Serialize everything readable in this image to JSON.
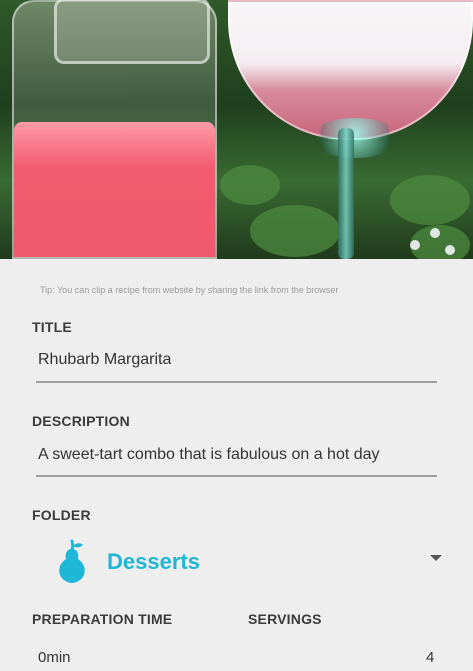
{
  "header_photo": {
    "description": ""
  },
  "form": {
    "tip": "Tip: You can clip a recipe from website by sharing the link from the browser",
    "title_label": "TITLE",
    "title_value": "Rhubarb Margarita",
    "description_label": "DESCRIPTION",
    "description_value": "A sweet-tart combo that is fabulous on a hot day",
    "folder_label": "FOLDER",
    "folder_value": "Desserts",
    "folder_icon": "pear-icon",
    "prep_label": "PREPARATION TIME",
    "prep_value": "0min",
    "servings_label": "SERVINGS",
    "servings_value": "4"
  },
  "colors": {
    "accent": "#1fb7d6",
    "label": "#3b3b3b",
    "underline": "#9e9e9e",
    "background": "#eeeeee"
  }
}
